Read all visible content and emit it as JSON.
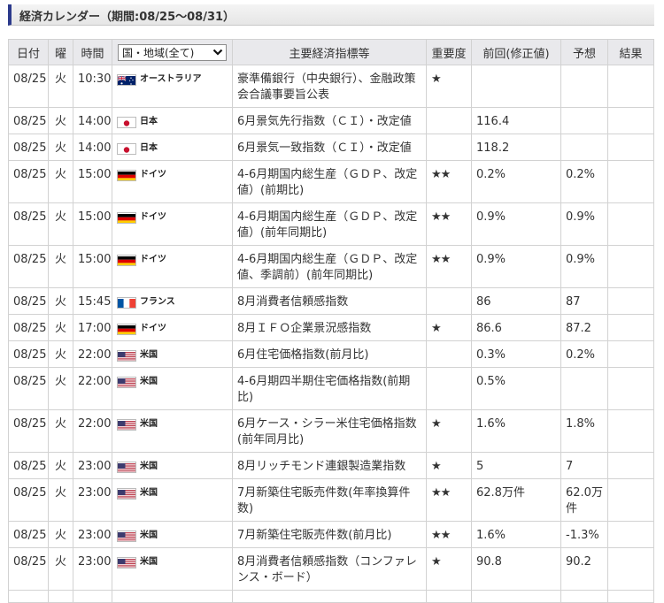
{
  "header": {
    "title": "経済カレンダー（期間:08/25〜08/31）"
  },
  "table": {
    "columns": {
      "date": "日付",
      "dow": "曜",
      "time": "時間",
      "country": "国・地域(全て)",
      "indicator": "主要経済指標等",
      "importance": "重要度",
      "previous": "前回(修正値)",
      "forecast": "予想",
      "result": "結果"
    },
    "rows": [
      {
        "date": "08/25",
        "dow": "火",
        "time": "10:30",
        "flag": "au-flag",
        "country": "オーストラリア",
        "indicator": "豪準備銀行（中央銀行）、金融政策会合議事要旨公表",
        "importance": "★",
        "previous": "",
        "forecast": "",
        "result": ""
      },
      {
        "date": "08/25",
        "dow": "火",
        "time": "14:00",
        "flag": "jp-flag",
        "country": "日本",
        "indicator": "6月景気先行指数（ＣＩ）・改定値",
        "importance": "",
        "previous": "116.4",
        "forecast": "",
        "result": ""
      },
      {
        "date": "08/25",
        "dow": "火",
        "time": "14:00",
        "flag": "jp-flag",
        "country": "日本",
        "indicator": "6月景気一致指数（ＣＩ）・改定値",
        "importance": "",
        "previous": "118.2",
        "forecast": "",
        "result": ""
      },
      {
        "date": "08/25",
        "dow": "火",
        "time": "15:00",
        "flag": "de-flag",
        "country": "ドイツ",
        "indicator": "4-6月期国内総生産（ＧＤＰ、改定値）(前期比)",
        "importance": "★★",
        "previous": "0.2%",
        "forecast": "0.2%",
        "result": ""
      },
      {
        "date": "08/25",
        "dow": "火",
        "time": "15:00",
        "flag": "de-flag",
        "country": "ドイツ",
        "indicator": "4-6月期国内総生産（ＧＤＰ、改定値）(前年同期比)",
        "importance": "★★",
        "previous": "0.9%",
        "forecast": "0.9%",
        "result": ""
      },
      {
        "date": "08/25",
        "dow": "火",
        "time": "15:00",
        "flag": "de-flag",
        "country": "ドイツ",
        "indicator": "4-6月期国内総生産（ＧＤＰ、改定値、季調前）(前年同期比)",
        "importance": "★★",
        "previous": "0.9%",
        "forecast": "0.9%",
        "result": ""
      },
      {
        "date": "08/25",
        "dow": "火",
        "time": "15:45",
        "flag": "fr-flag",
        "country": "フランス",
        "indicator": "8月消費者信頼感指数",
        "importance": "",
        "previous": "86",
        "forecast": "87",
        "result": ""
      },
      {
        "date": "08/25",
        "dow": "火",
        "time": "17:00",
        "flag": "de-flag",
        "country": "ドイツ",
        "indicator": "8月ＩＦＯ企業景況感指数",
        "importance": "★",
        "previous": "86.6",
        "forecast": "87.2",
        "result": ""
      },
      {
        "date": "08/25",
        "dow": "火",
        "time": "22:00",
        "flag": "us-flag",
        "country": "米国",
        "indicator": "6月住宅価格指数(前月比)",
        "importance": "",
        "previous": "0.3%",
        "forecast": "0.2%",
        "result": ""
      },
      {
        "date": "08/25",
        "dow": "火",
        "time": "22:00",
        "flag": "us-flag",
        "country": "米国",
        "indicator": "4-6月期四半期住宅価格指数(前期比)",
        "importance": "",
        "previous": "0.5%",
        "forecast": "",
        "result": ""
      },
      {
        "date": "08/25",
        "dow": "火",
        "time": "22:00",
        "flag": "us-flag",
        "country": "米国",
        "indicator": "6月ケース・シラー米住宅価格指数(前年同月比)",
        "importance": "★",
        "previous": "1.6%",
        "forecast": "1.8%",
        "result": ""
      },
      {
        "date": "08/25",
        "dow": "火",
        "time": "23:00",
        "flag": "us-flag",
        "country": "米国",
        "indicator": "8月リッチモンド連銀製造業指数",
        "importance": "★",
        "previous": "5",
        "forecast": "7",
        "result": ""
      },
      {
        "date": "08/25",
        "dow": "火",
        "time": "23:00",
        "flag": "us-flag",
        "country": "米国",
        "indicator": "7月新築住宅販売件数(年率換算件数)",
        "importance": "★★",
        "previous": "62.8万件",
        "forecast": "62.0万件",
        "result": ""
      },
      {
        "date": "08/25",
        "dow": "火",
        "time": "23:00",
        "flag": "us-flag",
        "country": "米国",
        "indicator": "7月新築住宅販売件数(前月比)",
        "importance": "★★",
        "previous": "1.6%",
        "forecast": "-1.3%",
        "result": ""
      },
      {
        "date": "08/25",
        "dow": "火",
        "time": "23:00",
        "flag": "us-flag",
        "country": "米国",
        "indicator": "8月消費者信頼感指数（コンファレンス・ボード）",
        "importance": "★",
        "previous": "90.8",
        "forecast": "90.2",
        "result": ""
      }
    ]
  },
  "colors": {
    "accent": "#2c3a8c",
    "header_bg": "#e9e9ec",
    "border": "#d2d2d2",
    "text": "#333333"
  }
}
